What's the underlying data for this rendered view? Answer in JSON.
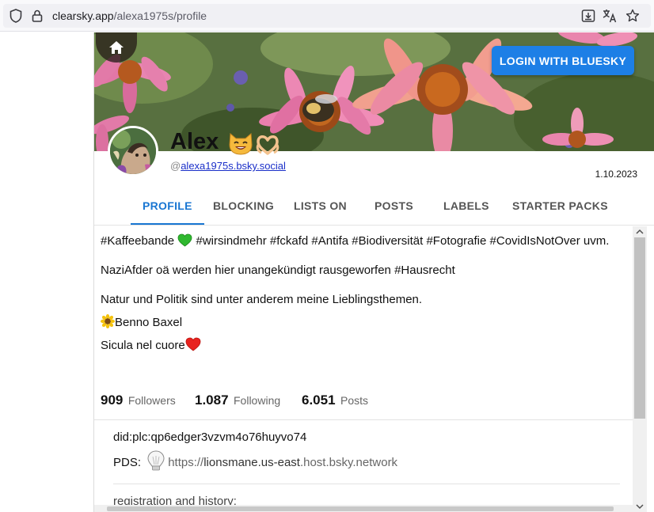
{
  "browser": {
    "url_host": "clearsky.app",
    "url_path": "/alexa1975s/profile",
    "icons": [
      "shield-icon",
      "lock-icon",
      "download-icon",
      "translate-icon",
      "star-icon"
    ]
  },
  "header": {
    "home_icon": "home-icon",
    "login_label": "LOGIN WITH BLUESKY",
    "accent_color": "#1d7fe6"
  },
  "profile": {
    "display_name": "Alex",
    "handle_prefix": "@",
    "handle": "alexa1975s.bsky.social",
    "joined_date": "1.10.2023",
    "name_emojis": [
      "smiling-cat-emoji",
      "heart-hands-emoji"
    ]
  },
  "tabs": [
    {
      "label": "PROFILE",
      "active": true
    },
    {
      "label": "BLOCKING",
      "active": false
    },
    {
      "label": "LISTS ON",
      "active": false
    },
    {
      "label": "POSTS",
      "active": false
    },
    {
      "label": "LABELS",
      "active": false
    },
    {
      "label": "STARTER PACKS",
      "active": false
    }
  ],
  "bio": {
    "line1a": "#Kaffeebande",
    "line1b": "#wirsindmehr #fckafd #Antifa #Biodiversität #Fotografie #CovidIsNotOver uvm.",
    "line2": "NaziAfder oä werden hier unangekündigt rausgeworfen #Hausrecht",
    "line3": "Natur und Politik sind unter anderem meine Lieblingsthemen.",
    "line4": "Benno Baxel",
    "line5": "Sicula nel cuore"
  },
  "stats": {
    "followers": {
      "value": "909",
      "label": "Followers"
    },
    "following": {
      "value": "1.087",
      "label": "Following"
    },
    "posts": {
      "value": "6.051",
      "label": "Posts"
    }
  },
  "details": {
    "did": "did:plc:qp6edger3vzvm4o76huyvo74",
    "pds_label": "PDS:",
    "pds_url_a": "https://",
    "pds_url_b": "lionsmane.us-east",
    "pds_url_c": ".host.bsky.network",
    "registration_label": "registration and history:"
  }
}
